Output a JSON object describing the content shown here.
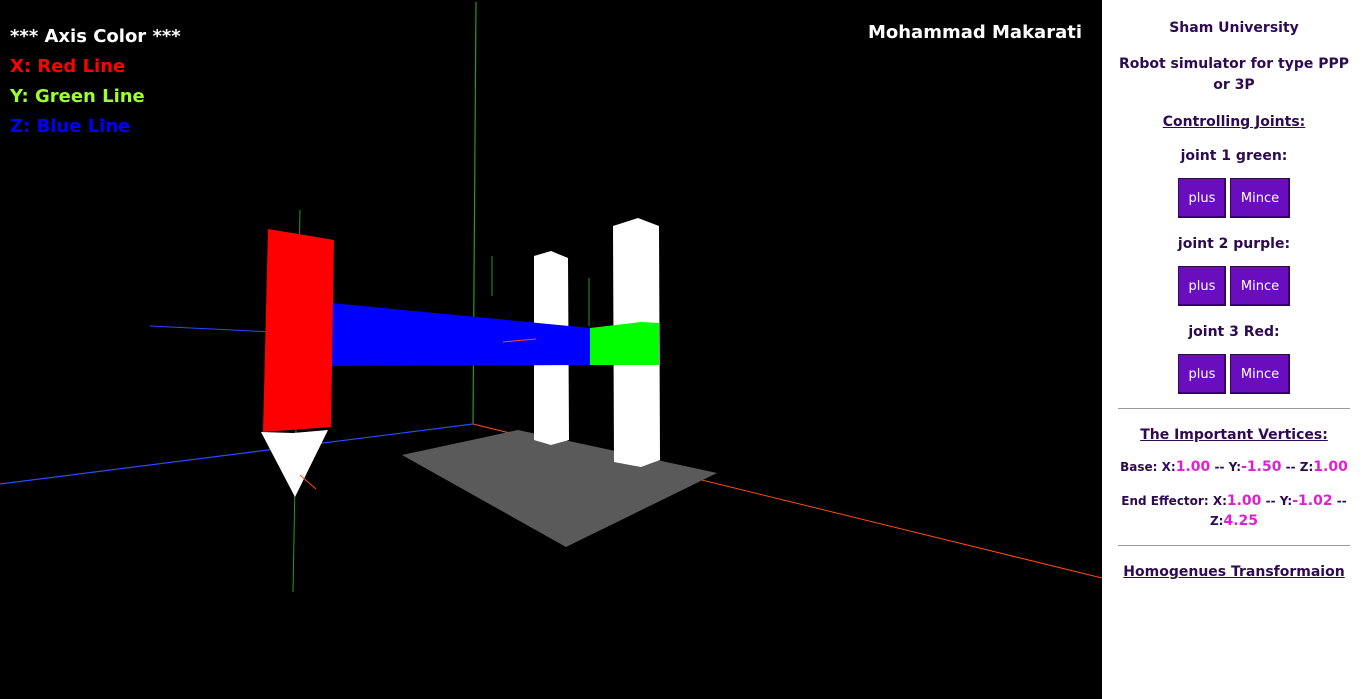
{
  "legend": {
    "title": "*** Axis Color ***",
    "x": {
      "prefix": "X:",
      "label": "Red Line",
      "color": "#ff0000"
    },
    "y": {
      "prefix": "Y:",
      "label": "Green Line",
      "color": "#9cff2e"
    },
    "z": {
      "prefix": "Z:",
      "label": "Blue Line",
      "color": "#0000ff"
    }
  },
  "author": "Mohammad Makarati",
  "panel": {
    "university": "Sham University",
    "subtitle": "Robot simulator for type PPP or 3P",
    "controlling_heading": "Controlling Joints:",
    "joints": [
      {
        "label": "joint 1 green:",
        "plus": "plus",
        "minus": "Mince"
      },
      {
        "label": "joint 2 purple:",
        "plus": "plus",
        "minus": "Mince"
      },
      {
        "label": "joint 3 Red:",
        "plus": "plus",
        "minus": "Mince"
      }
    ],
    "vertices_heading": "The Important Vertices:",
    "base": {
      "label": "Base:",
      "x_label": "X:",
      "x": "1.00",
      "y_label": "Y:",
      "y": "-1.50",
      "z_label": "Z:",
      "z": "1.00",
      "sep": "--"
    },
    "end_effector": {
      "label": "End Effector:",
      "x_label": "X:",
      "x": "1.00",
      "y_label": "Y:",
      "y": "-1.02",
      "z_label": "Z:",
      "z": "4.25",
      "sep": "--"
    },
    "homogeneous_link": "Homogenues Transformaion"
  },
  "colors": {
    "background": "#000000",
    "panel_bg": "#ffffff",
    "button": "#6a0dbf",
    "value": "#e020d0",
    "panel_text": "#2e0a52"
  }
}
